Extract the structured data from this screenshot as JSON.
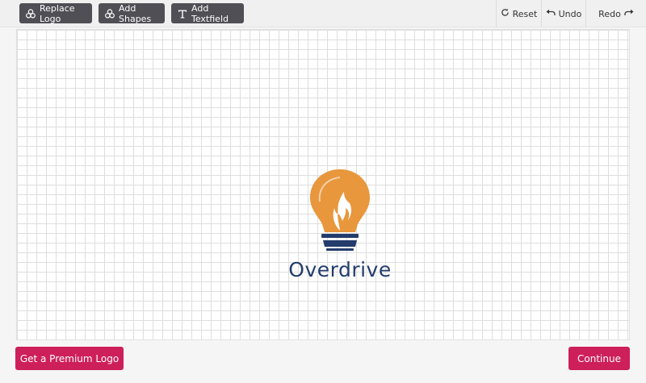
{
  "toolbar": {
    "replace_logo_label": "Replace Logo",
    "add_shapes_label": "Add Shapes",
    "add_textfield_label": "Add Textfield",
    "reset_label": "Reset",
    "undo_label": "Undo",
    "redo_label": "Redo"
  },
  "canvas": {
    "logo": {
      "brand_name": "Overdrive",
      "icon": "lightbulb-flame-icon",
      "bulb_color": "#e8973c",
      "text_color": "#233c6c"
    }
  },
  "footer": {
    "premium_label": "Get a Premium Logo",
    "continue_label": "Continue"
  },
  "colors": {
    "toolbar_button": "#4f4f55",
    "accent": "#cd1f59"
  }
}
